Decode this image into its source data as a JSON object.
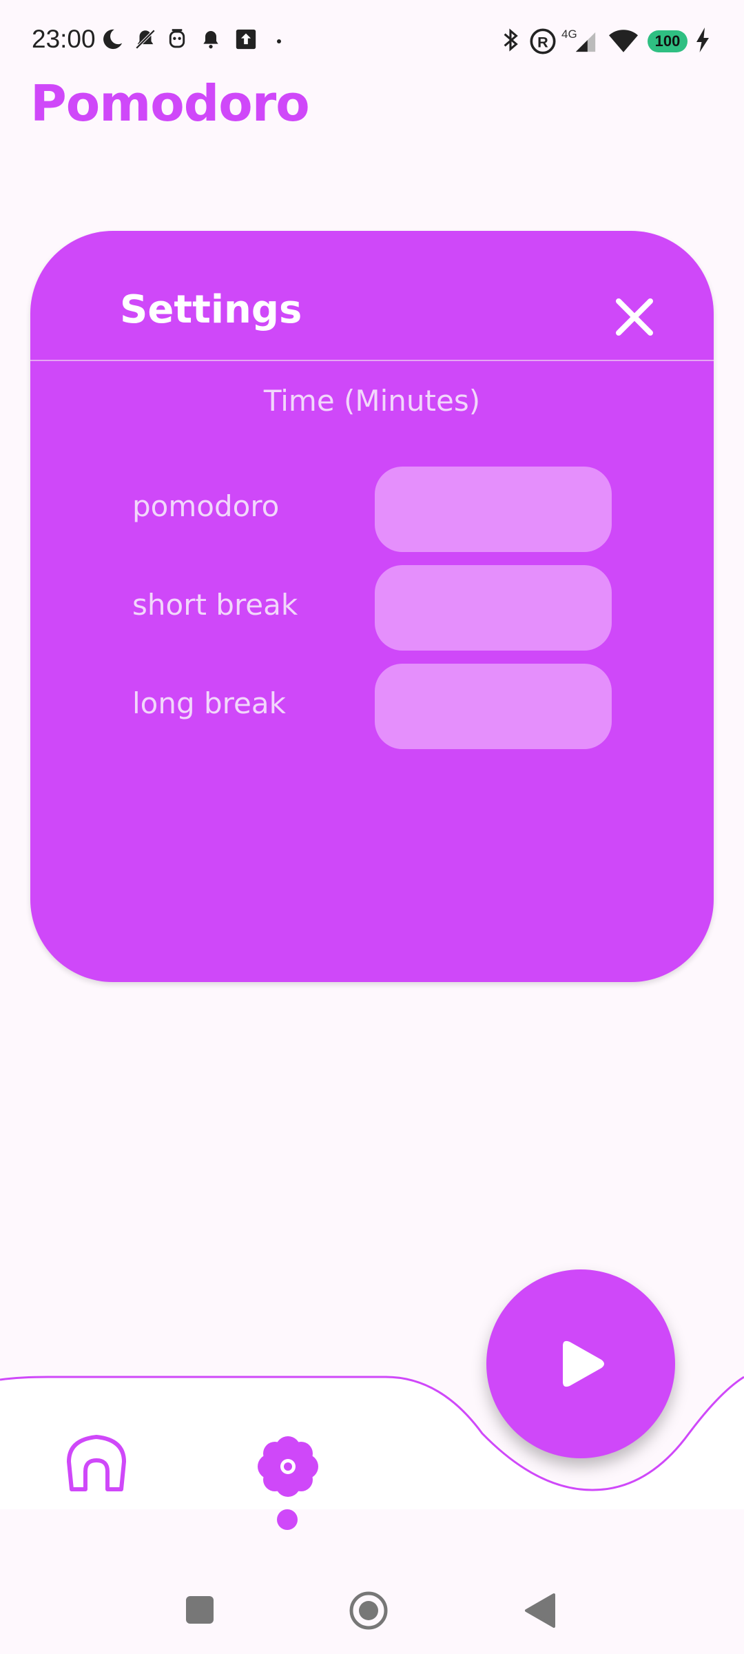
{
  "status_bar": {
    "time": "23:00",
    "network_label": "4G",
    "battery": "100",
    "icons": [
      "moon-icon",
      "bell-off-icon",
      "robot-icon",
      "bell-icon",
      "upload-icon",
      "dot-icon",
      "bluetooth-icon",
      "registered-icon",
      "signal-icon",
      "wifi-icon",
      "charging-icon"
    ]
  },
  "app": {
    "title": "Pomodoro"
  },
  "settings": {
    "title": "Settings",
    "section": "Time (Minutes)",
    "fields": [
      {
        "label": "pomodoro",
        "value": ""
      },
      {
        "label": "short break",
        "value": ""
      },
      {
        "label": "long break",
        "value": ""
      }
    ]
  },
  "bottom_nav": {
    "items": [
      "home-icon",
      "settings-icon"
    ],
    "active": "settings-icon",
    "fab_icon": "play-icon"
  },
  "colors": {
    "accent": "#cf48f9",
    "field_bg": "#e58ffc",
    "background": "#fef8fd"
  }
}
